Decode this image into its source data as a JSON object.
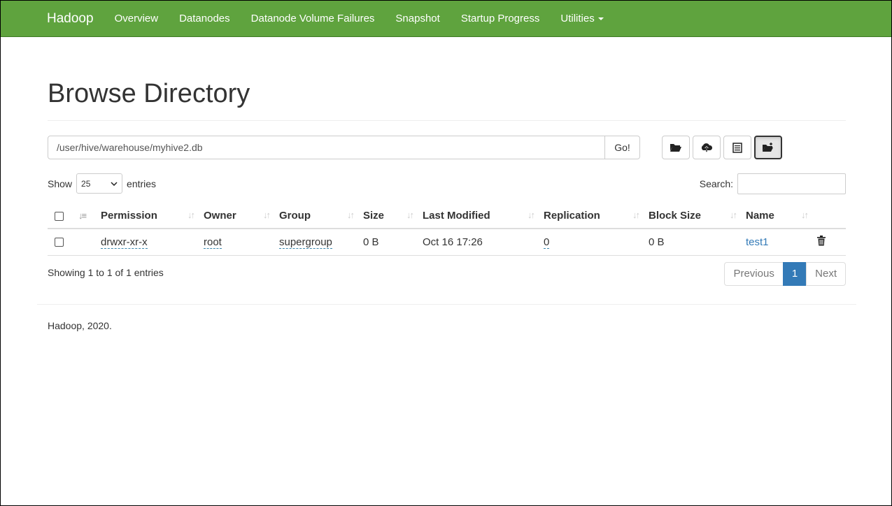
{
  "nav": {
    "brand": "Hadoop",
    "items": [
      "Overview",
      "Datanodes",
      "Datanode Volume Failures",
      "Snapshot",
      "Startup Progress",
      "Utilities"
    ]
  },
  "page": {
    "title": "Browse Directory",
    "path": "/user/hive/warehouse/myhive2.db",
    "go_label": "Go!"
  },
  "toolbar": {
    "icons": [
      "folder-open-icon",
      "cloud-upload-icon",
      "list-alt-icon",
      "folder-plus-icon"
    ]
  },
  "list": {
    "show_label": "Show",
    "entries_value": "25",
    "entries_label": "entries",
    "search_label": "Search:",
    "columns": [
      "Permission",
      "Owner",
      "Group",
      "Size",
      "Last Modified",
      "Replication",
      "Block Size",
      "Name"
    ],
    "rows": [
      {
        "permission": "drwxr-xr-x",
        "owner": "root",
        "group": "supergroup",
        "size": "0 B",
        "modified": "Oct 16 17:26",
        "replication": "0",
        "block_size": "0 B",
        "name": "test1"
      }
    ],
    "info": "Showing 1 to 1 of 1 entries",
    "pager": {
      "previous": "Previous",
      "page": "1",
      "next": "Next"
    }
  },
  "footer": {
    "text": "Hadoop, 2020."
  },
  "colors": {
    "navbar": "#5fa33e",
    "link": "#337ab7",
    "pager_active": "#337ab7"
  }
}
